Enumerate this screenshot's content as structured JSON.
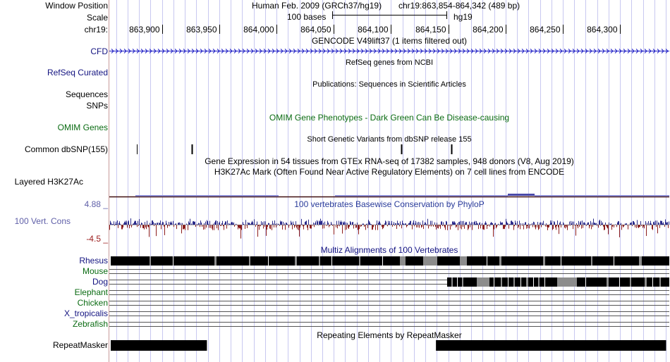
{
  "header": {
    "window_position_label": "Window Position",
    "assembly": "Human Feb. 2009 (GRCh37/hg19)",
    "position": "chr19:863,854-864,342 (489 bp)",
    "scale_label": "Scale",
    "scale_bar_text": "100 bases",
    "db": "hg19",
    "chrom_label": "chr19:",
    "ticks": [
      {
        "label": "863,900",
        "value": 863900
      },
      {
        "label": "863,950",
        "value": 863950
      },
      {
        "label": "864,000",
        "value": 864000
      },
      {
        "label": "864,050",
        "value": 864050
      },
      {
        "label": "864,100",
        "value": 864100
      },
      {
        "label": "864,150",
        "value": 864150
      },
      {
        "label": "864,200",
        "value": 864200
      },
      {
        "label": "864,250",
        "value": 864250
      },
      {
        "label": "864,300",
        "value": 864300
      }
    ],
    "window_start": 863854,
    "window_end": 864342
  },
  "tracks": {
    "gencode_title": "GENCODE V49lift37 (1 items filtered out)",
    "cfd_label": "CFD",
    "refseq_title": "RefSeq genes from NCBI",
    "refseq_label": "RefSeq Curated",
    "pubs_title": "Publications: Sequences in Scientific Articles",
    "sequences_label": "Sequences",
    "snps_label": "SNPs",
    "omim_title": "OMIM Gene Phenotypes - Dark Green Can Be Disease-causing",
    "omim_label": "OMIM Genes",
    "dbsnp_title": "Short Genetic Variants from dbSNP release 155",
    "dbsnp_label": "Common dbSNP(155)",
    "dbsnp_positions": [
      863878,
      863926,
      864109,
      864153
    ],
    "gtex_title": "Gene Expression in 54 tissues from GTEx RNA-seq of 17382 samples, 948 donors (V8, Aug 2019)",
    "h3k27ac_title": "H3K27Ac Mark (Often Found Near Active Regulatory Elements) on 7 cell lines from ENCODE",
    "h3k27ac_label": "Layered H3K27Ac",
    "cons_max": "4.88 _",
    "cons_min": "-4.5 _",
    "cons_title": "100 vertebrates Basewise Conservation by PhyloP",
    "cons_label": "100 Vert. Cons",
    "multiz_title": "Multiz Alignments of 100 Vertebrates",
    "species": [
      {
        "name": "Rhesus",
        "color": "#131380"
      },
      {
        "name": "Mouse",
        "color": "#0a6b12"
      },
      {
        "name": "Dog",
        "color": "#131380"
      },
      {
        "name": "Elephant",
        "color": "#0a6b12"
      },
      {
        "name": "Chicken",
        "color": "#0a6b12"
      },
      {
        "name": "X_tropicalis",
        "color": "#131380"
      },
      {
        "name": "Zebrafish",
        "color": "#0a6b12"
      }
    ],
    "repeat_title": "Repeating Elements by RepeatMasker",
    "repeat_label": "RepeatMasker",
    "repeat_blocks": [
      [
        863854,
        863938
      ],
      [
        864138,
        864339
      ]
    ]
  },
  "colors": {
    "guide": "#c8c8f0",
    "cfd_arrow": "#1c1cc4",
    "cons_pos": "#2c2c8c",
    "cons_neg": "#8c1c1c",
    "align_dark": "#000000",
    "align_gray": "#8c8c8c"
  }
}
